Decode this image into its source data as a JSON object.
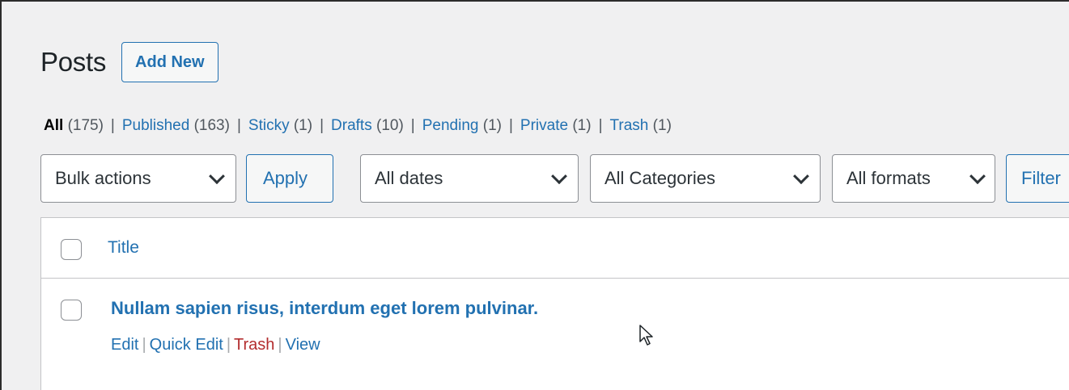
{
  "page": {
    "title": "Posts",
    "add_new_label": "Add New"
  },
  "status_filters": [
    {
      "label": "All",
      "count": "(175)"
    },
    {
      "label": "Published",
      "count": "(163)"
    },
    {
      "label": "Sticky",
      "count": "(1)"
    },
    {
      "label": "Drafts",
      "count": "(10)"
    },
    {
      "label": "Pending",
      "count": "(1)"
    },
    {
      "label": "Private",
      "count": "(1)"
    },
    {
      "label": "Trash",
      "count": "(1)"
    }
  ],
  "separator": "|",
  "toolbar": {
    "bulk_actions": "Bulk actions",
    "apply_label": "Apply",
    "dates": "All dates",
    "categories": "All Categories",
    "formats": "All formats",
    "filter_label": "Filter"
  },
  "table": {
    "column_title": "Title",
    "rows": [
      {
        "title": "Nullam sapien risus, interdum eget lorem pulvinar.",
        "actions": {
          "edit": "Edit",
          "quick_edit": "Quick Edit",
          "trash": "Trash",
          "view": "View"
        }
      }
    ]
  },
  "colors": {
    "link": "#2271b1",
    "trash_link": "#b32d2e",
    "background": "#f0f0f1"
  },
  "icons": {
    "dropdown": "chevron-down-icon",
    "cursor": "mouse-pointer-icon"
  }
}
